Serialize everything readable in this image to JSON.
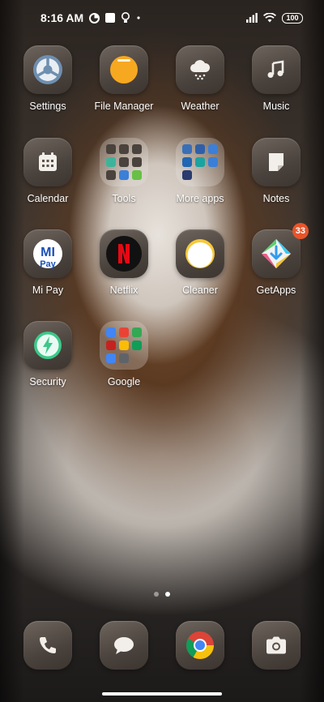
{
  "status_bar": {
    "time": "8:16 AM",
    "left_icons": [
      "data-saver-icon",
      "square-notification-icon",
      "bulb-icon",
      "dot-icon"
    ],
    "right_icons": [
      "signal-icon",
      "wifi-icon"
    ],
    "battery": "100"
  },
  "apps": [
    {
      "id": "settings",
      "label": "Settings",
      "icon": "settings-icon"
    },
    {
      "id": "file-manager",
      "label": "File Manager",
      "icon": "file-manager-icon"
    },
    {
      "id": "weather",
      "label": "Weather",
      "icon": "weather-cloud-icon"
    },
    {
      "id": "music",
      "label": "Music",
      "icon": "music-note-icon"
    },
    {
      "id": "calendar",
      "label": "Calendar",
      "icon": "calendar-icon"
    },
    {
      "id": "tools",
      "label": "Tools",
      "icon": "folder-icon"
    },
    {
      "id": "more-apps",
      "label": "More apps",
      "icon": "folder-icon"
    },
    {
      "id": "notes",
      "label": "Notes",
      "icon": "notes-icon"
    },
    {
      "id": "mi-pay",
      "label": "Mi Pay",
      "icon": "mi-pay-icon"
    },
    {
      "id": "netflix",
      "label": "Netflix",
      "icon": "netflix-icon"
    },
    {
      "id": "cleaner",
      "label": "Cleaner",
      "icon": "cleaner-icon"
    },
    {
      "id": "getapps",
      "label": "GetApps",
      "icon": "getapps-icon",
      "badge": "33"
    },
    {
      "id": "security",
      "label": "Security",
      "icon": "security-bolt-icon"
    },
    {
      "id": "google",
      "label": "Google",
      "icon": "folder-icon"
    }
  ],
  "dock": [
    {
      "id": "phone",
      "icon": "phone-icon"
    },
    {
      "id": "messages",
      "icon": "message-bubble-icon"
    },
    {
      "id": "chrome",
      "icon": "chrome-icon"
    },
    {
      "id": "camera",
      "icon": "camera-icon"
    }
  ],
  "pages": {
    "count": 2,
    "active": 2
  },
  "colors": {
    "badge": "#e8542a",
    "file_manager": "#f6a821",
    "security": "#3cc88a",
    "netflix_red": "#e50914"
  }
}
